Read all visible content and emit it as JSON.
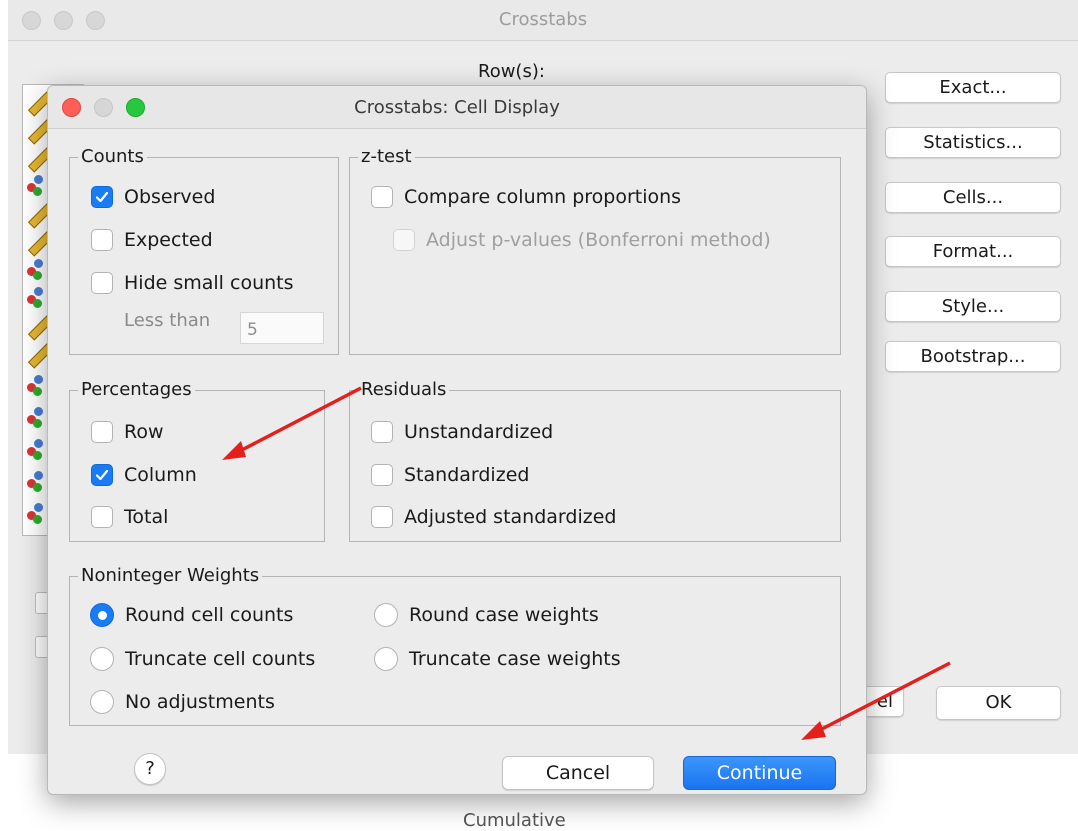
{
  "main_window": {
    "title": "Crosstabs",
    "rows_label": "Row(s):",
    "side_buttons": [
      "Exact...",
      "Statistics...",
      "Cells...",
      "Format...",
      "Style...",
      "Bootstrap..."
    ],
    "ok_label": "OK",
    "cancel_fragment": "el",
    "partial_text": "Cumulative"
  },
  "dialog": {
    "title": "Crosstabs: Cell Display",
    "counts": {
      "legend": "Counts",
      "observed": "Observed",
      "expected": "Expected",
      "hide_small": "Hide small counts",
      "less_than": "Less than",
      "less_than_value": "5"
    },
    "ztest": {
      "legend": "z-test",
      "compare": "Compare column proportions",
      "adjust": "Adjust p-values (Bonferroni method)"
    },
    "percentages": {
      "legend": "Percentages",
      "row": "Row",
      "column": "Column",
      "total": "Total"
    },
    "residuals": {
      "legend": "Residuals",
      "unstandardized": "Unstandardized",
      "standardized": "Standardized",
      "adjusted": "Adjusted standardized"
    },
    "weights": {
      "legend": "Noninteger Weights",
      "round_cell": "Round cell counts",
      "round_case": "Round case weights",
      "truncate_cell": "Truncate cell counts",
      "truncate_case": "Truncate case weights",
      "no_adjust": "No adjustments"
    },
    "help_label": "?",
    "cancel_label": "Cancel",
    "continue_label": "Continue"
  },
  "colors": {
    "accent": "#1a7cf5",
    "arrow": "#e3201b"
  }
}
